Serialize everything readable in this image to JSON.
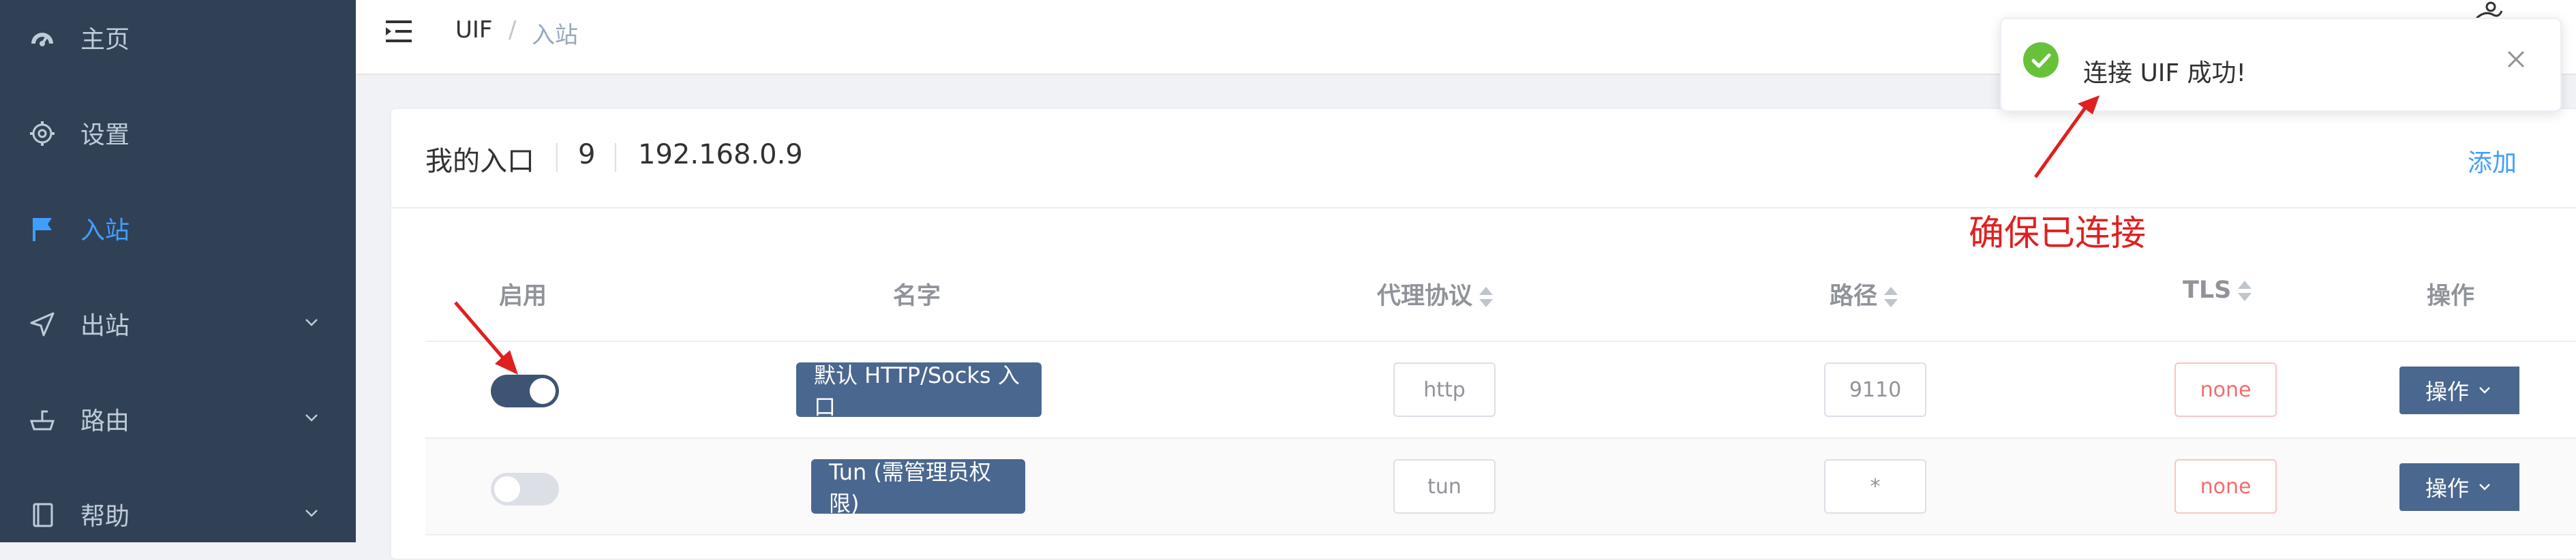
{
  "sidebar": {
    "items": [
      {
        "label": "主页",
        "icon": "dashboard-icon"
      },
      {
        "label": "设置",
        "icon": "gear-icon"
      },
      {
        "label": "入站",
        "icon": "flag-icon",
        "active": true
      },
      {
        "label": "出站",
        "icon": "send-icon",
        "expandable": true
      },
      {
        "label": "路由",
        "icon": "router-icon",
        "expandable": true
      },
      {
        "label": "帮助",
        "icon": "book-icon",
        "expandable": true
      }
    ]
  },
  "breadcrumb": {
    "root": "UIF",
    "separator": "/",
    "current": "入站"
  },
  "card": {
    "title": "我的入口",
    "count": "9",
    "address": "192.168.0.9",
    "add_label": "添加"
  },
  "table": {
    "headers": {
      "enabled": "启用",
      "name": "名字",
      "protocol": "代理协议",
      "path": "路径",
      "tls": "TLS",
      "actions": "操作"
    },
    "rows": [
      {
        "enabled": true,
        "name": "默认 HTTP/Socks 入口",
        "protocol": "http",
        "path": "9110",
        "tls": "none",
        "action": "操作"
      },
      {
        "enabled": false,
        "name": "Tun (需管理员权限)",
        "protocol": "tun",
        "path": "*",
        "tls": "none",
        "action": "操作"
      }
    ]
  },
  "toast": {
    "message": "连接 UIF 成功!",
    "icon": "success-check-icon"
  },
  "annotation": {
    "text": "确保已连接",
    "color": "#e02020"
  },
  "colors": {
    "sidebar": "#304156",
    "accent": "#409eff",
    "button": "#4a678f",
    "success": "#67c23a",
    "switch_on": "#3e5474"
  }
}
